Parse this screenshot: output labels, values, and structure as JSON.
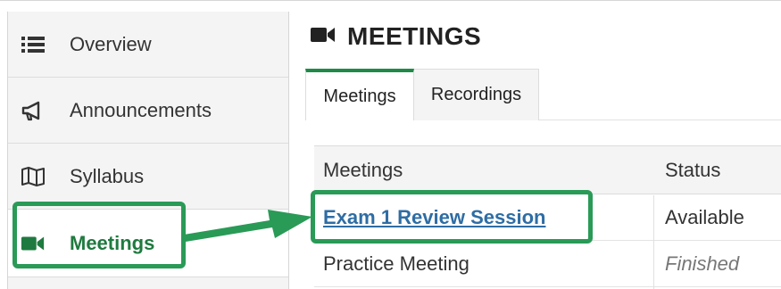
{
  "sidebar": {
    "items": [
      {
        "label": "Overview",
        "icon": "list-icon"
      },
      {
        "label": "Announcements",
        "icon": "megaphone-icon"
      },
      {
        "label": "Syllabus",
        "icon": "map-icon"
      },
      {
        "label": "Meetings",
        "icon": "video-camera-icon"
      }
    ],
    "active_index": 3
  },
  "main": {
    "title": "MEETINGS",
    "title_icon": "video-camera-icon",
    "tabs": [
      {
        "label": "Meetings",
        "active": true
      },
      {
        "label": "Recordings",
        "active": false
      }
    ],
    "table": {
      "headers": [
        "Meetings",
        "Status"
      ],
      "rows": [
        {
          "meeting": "Exam 1 Review Session",
          "status": "Available",
          "is_link": true
        },
        {
          "meeting": "Practice Meeting",
          "status": "Finished",
          "is_link": false
        }
      ]
    }
  },
  "colors": {
    "highlight": "#2a9a57",
    "active_green": "#1f7a3f",
    "link_blue": "#2e6da4"
  }
}
